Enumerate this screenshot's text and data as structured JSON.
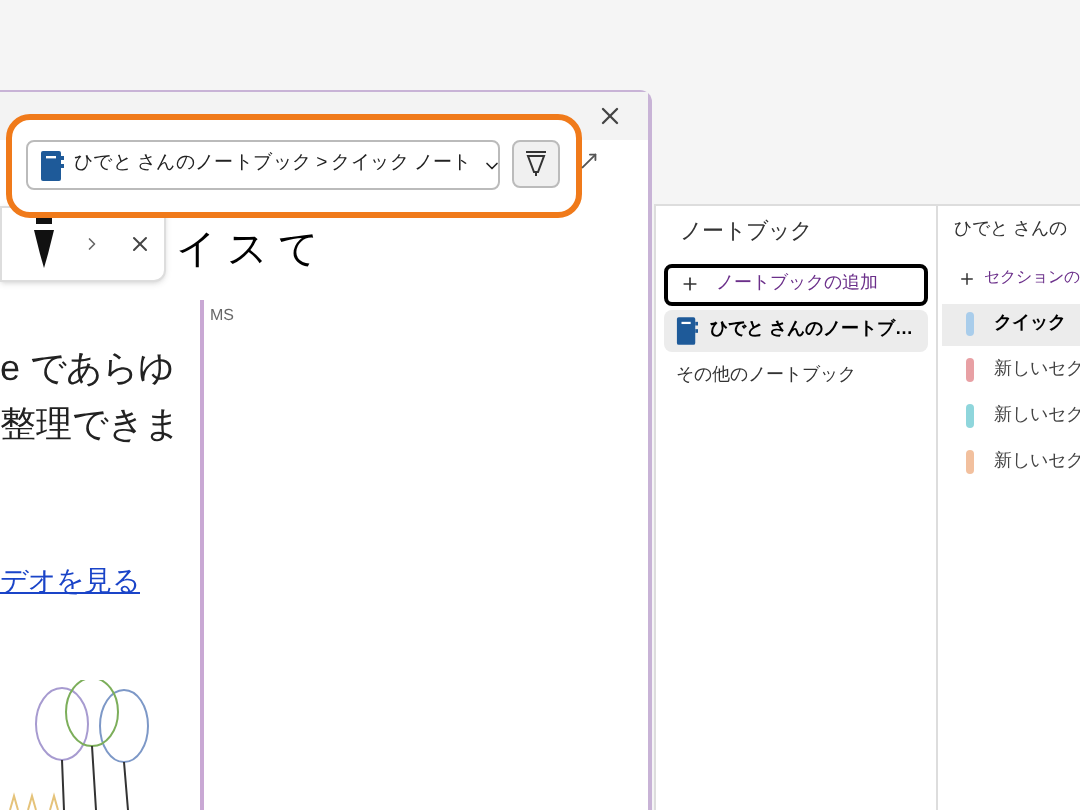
{
  "background_page": {
    "heading_fragment": "イ ス て",
    "body_lines": [
      "e であらゆ",
      "整理できま"
    ],
    "video_link": "デオを見る",
    "author_tag": "MS"
  },
  "location_picker": {
    "path": "ひでと さんのノートブック > クイック ノート"
  },
  "notebooks_pane": {
    "title": "ノートブック",
    "add_label": "ノートブックの追加",
    "items": [
      {
        "kind": "notebook",
        "label": "ひでと さんのノートブ…",
        "selected": true
      },
      {
        "kind": "link",
        "label": "その他のノートブック",
        "selected": false
      }
    ]
  },
  "sections_pane": {
    "title": "ひでと さんの",
    "add_label": "セクションの",
    "sections": [
      {
        "label": "クイック",
        "color": "#a9cdeb",
        "selected": true
      },
      {
        "label": "新しいセク",
        "color": "#e8a0a4",
        "selected": false
      },
      {
        "label": "新しいセク",
        "color": "#8fd6dc",
        "selected": false
      },
      {
        "label": "新しいセク",
        "color": "#f2c09e",
        "selected": false
      }
    ]
  }
}
